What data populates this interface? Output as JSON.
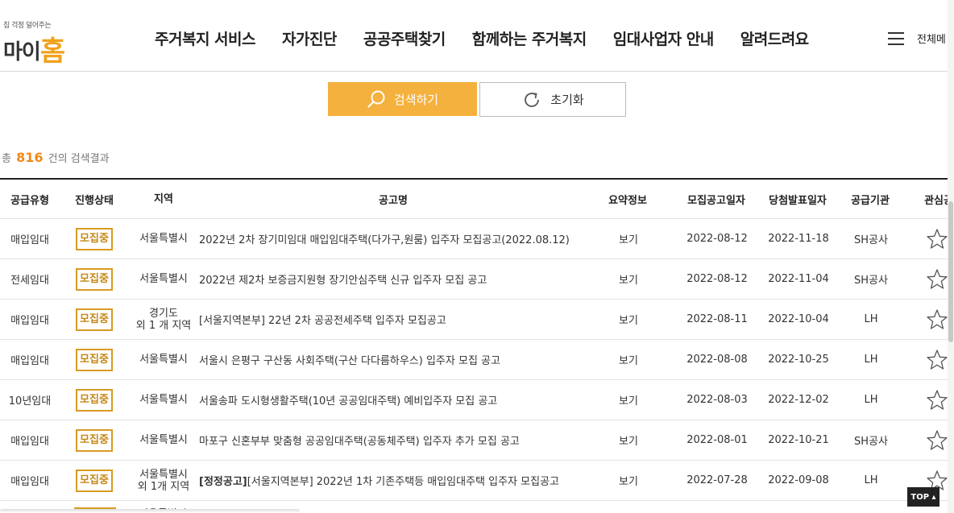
{
  "header": {
    "logo_tagline": "집 걱정 덜어주는",
    "logo_text": "마이",
    "logo_accent": "홈",
    "nav": [
      {
        "label": "주거복지 서비스",
        "active": false
      },
      {
        "label": "자가진단",
        "active": false
      },
      {
        "label": "공공주택찾기",
        "active": true
      },
      {
        "label": "함께하는 주거복지",
        "active": false
      },
      {
        "label": "임대사업자 안내",
        "active": false
      },
      {
        "label": "알려드려요",
        "active": false
      }
    ],
    "all_menu": "전체메",
    "menu_icon": "hamburger-icon"
  },
  "search": {
    "search_label": "검색하기",
    "reset_label": "초기화",
    "search_icon": "search-icon",
    "reset_icon": "refresh-icon"
  },
  "result": {
    "prefix": "총",
    "count": "816",
    "suffix": "건의 검색결과"
  },
  "table": {
    "headers": [
      "공급유형",
      "진행상태",
      "지역",
      "공고명",
      "요약정보",
      "모집공고일자",
      "당첨발표일자",
      "공급기관",
      "관심공고"
    ],
    "rows": [
      {
        "type": "매입임대",
        "status": "모집중",
        "region": "서울특별시",
        "region2": "",
        "title_prefix": "",
        "title": "2022년 2차 장기미임대 매입임대주택(다가구,원룸) 입주자 모집공고(2022.08.12)",
        "summary": "보기",
        "notice_date": "2022-08-12",
        "announce_date": "2022-11-18",
        "agency": "SH공사"
      },
      {
        "type": "전세임대",
        "status": "모집중",
        "region": "서울특별시",
        "region2": "",
        "title_prefix": "",
        "title": "2022년 제2차 보증금지원형 장기안심주택 신규 입주자 모집 공고",
        "summary": "보기",
        "notice_date": "2022-08-12",
        "announce_date": "2022-11-04",
        "agency": "SH공사"
      },
      {
        "type": "매입임대",
        "status": "모집중",
        "region": "경기도",
        "region2": "외 1 개 지역",
        "title_prefix": "",
        "title": "[서울지역본부] 22년 2차 공공전세주택 입주자 모집공고",
        "summary": "보기",
        "notice_date": "2022-08-11",
        "announce_date": "2022-10-04",
        "agency": "LH"
      },
      {
        "type": "매입임대",
        "status": "모집중",
        "region": "서울특별시",
        "region2": "",
        "title_prefix": "",
        "title": "서울시 은평구 구산동 사회주택(구산 다다름하우스) 입주자 모집 공고",
        "summary": "보기",
        "notice_date": "2022-08-08",
        "announce_date": "2022-10-25",
        "agency": "LH"
      },
      {
        "type": "10년임대",
        "status": "모집중",
        "region": "서울특별시",
        "region2": "",
        "title_prefix": "",
        "title": "서울송파 도시형생활주택(10년 공공임대주택) 예비입주자 모집 공고",
        "summary": "보기",
        "notice_date": "2022-08-03",
        "announce_date": "2022-12-02",
        "agency": "LH"
      },
      {
        "type": "매입임대",
        "status": "모집중",
        "region": "서울특별시",
        "region2": "",
        "title_prefix": "",
        "title": "마포구 신혼부부 맞춤형 공공임대주택(공동체주택) 입주자 추가 모집 공고",
        "summary": "보기",
        "notice_date": "2022-08-01",
        "announce_date": "2022-10-21",
        "agency": "SH공사"
      },
      {
        "type": "매입임대",
        "status": "모집중",
        "region": "서울특별시",
        "region2": "외 1개 지역",
        "title_prefix": "[정정공고]",
        "title": "[서울지역본부] 2022년 1차 기존주택등 매입임대주택 입주자 모집공고",
        "summary": "보기",
        "notice_date": "2022-07-28",
        "announce_date": "2022-09-08",
        "agency": "LH"
      }
    ],
    "partial_row_region": "서울특별시",
    "star_icon": "star-outline-icon"
  },
  "top_button": "TOP ▴",
  "colors": {
    "accent": "#f5b13d",
    "badge": "#d99a24",
    "count": "#f0891b"
  }
}
